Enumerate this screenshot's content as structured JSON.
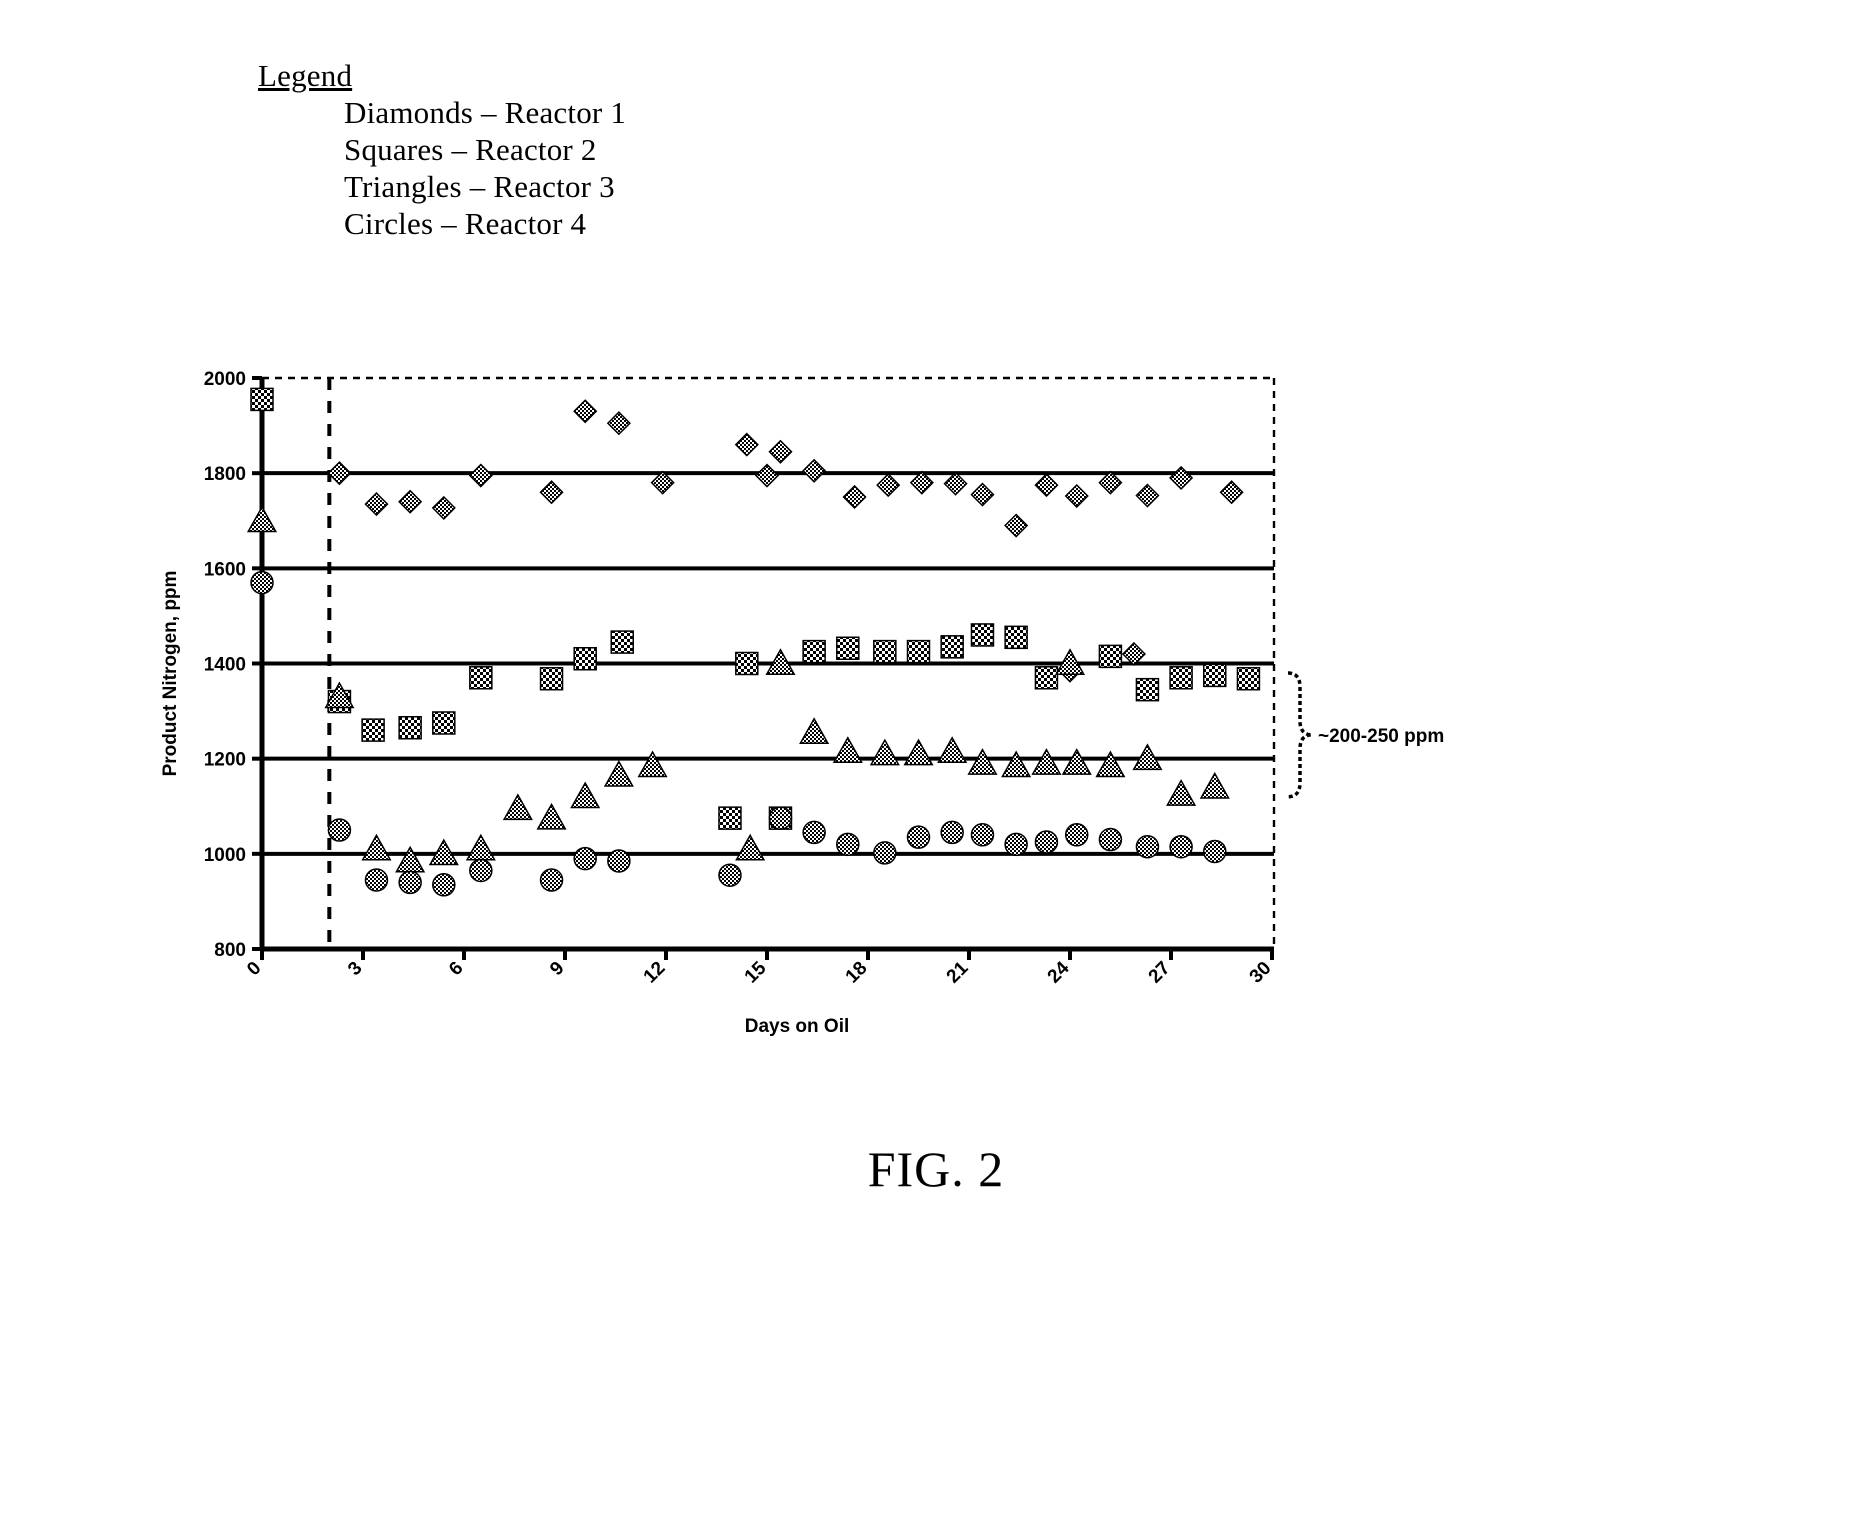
{
  "legend": {
    "title": "Legend",
    "entries": [
      "Diamonds – Reactor 1",
      "Squares – Reactor 2",
      "Triangles – Reactor 3",
      "Circles – Reactor 4"
    ]
  },
  "figure": {
    "caption": "FIG. 2"
  },
  "annotation": {
    "bracket_label": "~200-250 ppm"
  },
  "chart_data": {
    "type": "scatter",
    "title": "",
    "xlabel": "Days on Oil",
    "ylabel": "Product Nitrogen, ppm",
    "xlim": [
      0,
      30
    ],
    "ylim": [
      800,
      2000
    ],
    "xticks": [
      0,
      3,
      6,
      9,
      12,
      15,
      18,
      21,
      24,
      27,
      30
    ],
    "xtick_labels": [
      "0",
      "3",
      "6",
      "9",
      "12",
      "15",
      "18",
      "21",
      "24",
      "27",
      "30"
    ],
    "yticks": [
      800,
      1000,
      1200,
      1400,
      1600,
      1800,
      2000
    ],
    "ytick_labels": [
      "800",
      "1000",
      "1200",
      "1400",
      "1600",
      "1800",
      "2000"
    ],
    "gridlines_y": [
      1000,
      1200,
      1400,
      1600,
      1800
    ],
    "grid": true,
    "legend_position": "external-top-left",
    "vertical_dashed_line_x": 2,
    "series": [
      {
        "name": "Reactor 1",
        "marker": "diamond",
        "points": [
          [
            2.3,
            1800
          ],
          [
            3.4,
            1735
          ],
          [
            4.4,
            1740
          ],
          [
            5.4,
            1727
          ],
          [
            6.5,
            1795
          ],
          [
            8.6,
            1760
          ],
          [
            9.6,
            1930
          ],
          [
            10.6,
            1905
          ],
          [
            11.9,
            1780
          ],
          [
            14.4,
            1860
          ],
          [
            15.4,
            1845
          ],
          [
            16.4,
            1805
          ],
          [
            17.6,
            1750
          ],
          [
            18.6,
            1775
          ],
          [
            19.6,
            1780
          ],
          [
            20.6,
            1778
          ],
          [
            21.4,
            1755
          ],
          [
            22.4,
            1690
          ],
          [
            23.3,
            1775
          ],
          [
            24.2,
            1752
          ],
          [
            25.2,
            1780
          ],
          [
            26.3,
            1753
          ],
          [
            27.3,
            1790
          ],
          [
            28.8,
            1760
          ],
          [
            25.9,
            1420
          ],
          [
            24.0,
            1385
          ],
          [
            15.0,
            1795
          ]
        ]
      },
      {
        "name": "Reactor 2",
        "marker": "square",
        "points": [
          [
            0.0,
            1955
          ],
          [
            2.3,
            1320
          ],
          [
            3.3,
            1260
          ],
          [
            4.4,
            1265
          ],
          [
            5.4,
            1275
          ],
          [
            6.5,
            1370
          ],
          [
            8.6,
            1368
          ],
          [
            9.6,
            1410
          ],
          [
            10.7,
            1445
          ],
          [
            13.9,
            1075
          ],
          [
            14.4,
            1400
          ],
          [
            15.4,
            1075
          ],
          [
            16.4,
            1425
          ],
          [
            17.4,
            1432
          ],
          [
            18.5,
            1425
          ],
          [
            19.5,
            1425
          ],
          [
            20.5,
            1435
          ],
          [
            21.4,
            1460
          ],
          [
            22.4,
            1455
          ],
          [
            23.3,
            1370
          ],
          [
            25.2,
            1415
          ],
          [
            26.3,
            1345
          ],
          [
            27.3,
            1370
          ],
          [
            28.3,
            1375
          ],
          [
            29.3,
            1368
          ]
        ]
      },
      {
        "name": "Reactor 3",
        "marker": "triangle",
        "points": [
          [
            0.0,
            1700
          ],
          [
            2.3,
            1330
          ],
          [
            3.4,
            1010
          ],
          [
            4.4,
            985
          ],
          [
            5.4,
            1000
          ],
          [
            6.5,
            1010
          ],
          [
            7.6,
            1095
          ],
          [
            8.6,
            1075
          ],
          [
            9.6,
            1120
          ],
          [
            10.6,
            1165
          ],
          [
            11.6,
            1185
          ],
          [
            14.5,
            1010
          ],
          [
            15.4,
            1400
          ],
          [
            16.4,
            1255
          ],
          [
            17.4,
            1215
          ],
          [
            18.5,
            1210
          ],
          [
            19.5,
            1210
          ],
          [
            20.5,
            1215
          ],
          [
            21.4,
            1190
          ],
          [
            22.4,
            1185
          ],
          [
            23.3,
            1190
          ],
          [
            24.2,
            1190
          ],
          [
            25.2,
            1185
          ],
          [
            26.3,
            1200
          ],
          [
            27.3,
            1125
          ],
          [
            28.3,
            1140
          ],
          [
            24.0,
            1400
          ]
        ]
      },
      {
        "name": "Reactor 4",
        "marker": "circle",
        "points": [
          [
            0.0,
            1570
          ],
          [
            2.3,
            1050
          ],
          [
            3.4,
            945
          ],
          [
            4.4,
            940
          ],
          [
            5.4,
            935
          ],
          [
            6.5,
            965
          ],
          [
            8.6,
            945
          ],
          [
            9.6,
            990
          ],
          [
            10.6,
            985
          ],
          [
            13.9,
            955
          ],
          [
            15.4,
            1075
          ],
          [
            16.4,
            1045
          ],
          [
            17.4,
            1020
          ],
          [
            18.5,
            1002
          ],
          [
            19.5,
            1035
          ],
          [
            20.5,
            1045
          ],
          [
            21.4,
            1040
          ],
          [
            22.4,
            1020
          ],
          [
            23.3,
            1025
          ],
          [
            24.2,
            1040
          ],
          [
            25.2,
            1030
          ],
          [
            26.3,
            1015
          ],
          [
            27.3,
            1015
          ],
          [
            28.3,
            1005
          ]
        ]
      }
    ]
  }
}
